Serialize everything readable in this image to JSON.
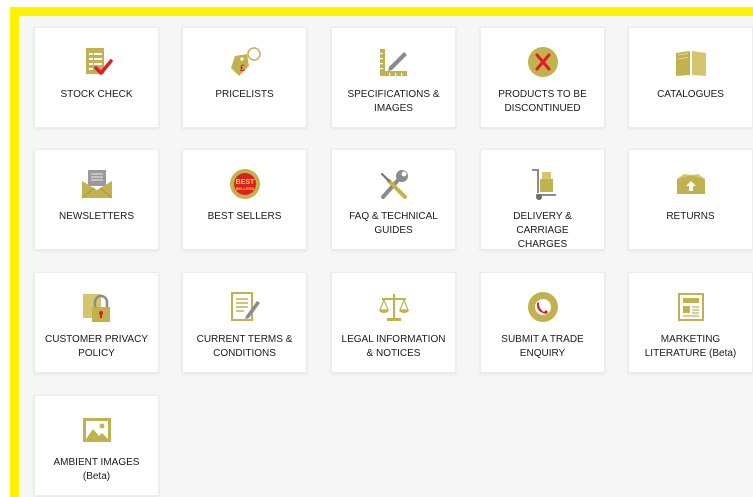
{
  "accent_color": "#fff200",
  "icon_color": "#c2b24f",
  "tiles": [
    {
      "label": "STOCK CHECK",
      "icon": "checklist-icon"
    },
    {
      "label": "PRICELISTS",
      "icon": "price-tag-icon"
    },
    {
      "label": "SPECIFICATIONS &\nIMAGES",
      "icon": "ruler-pencil-icon"
    },
    {
      "label": "PRODUCTS TO BE\nDISCONTINUED",
      "icon": "discontinued-x-icon"
    },
    {
      "label": "CATALOGUES",
      "icon": "open-book-icon"
    },
    {
      "label": "NEWSLETTERS",
      "icon": "envelope-icon"
    },
    {
      "label": "BEST SELLERS",
      "icon": "best-sellers-badge-icon",
      "badge_text": "BEST",
      "badge_subtext": "SELLERS"
    },
    {
      "label": "FAQ & TECHNICAL\nGUIDES",
      "icon": "wrench-screwdriver-icon"
    },
    {
      "label": "DELIVERY & CARRIAGE\nCHARGES",
      "icon": "hand-truck-icon"
    },
    {
      "label": "RETURNS",
      "icon": "return-box-icon"
    },
    {
      "label": "CUSTOMER PRIVACY\nPOLICY",
      "icon": "padlock-icon"
    },
    {
      "label": "CURRENT TERMS &\nCONDITIONS",
      "icon": "document-pen-icon"
    },
    {
      "label": "LEGAL INFORMATION\n& NOTICES",
      "icon": "scales-icon"
    },
    {
      "label": "SUBMIT A TRADE\nENQUIRY",
      "icon": "phone-circle-icon"
    },
    {
      "label": "MARKETING\nLITERATURE (Beta)",
      "icon": "newspaper-icon"
    },
    {
      "label": "AMBIENT IMAGES\n(Beta)",
      "icon": "landscape-image-icon"
    }
  ]
}
